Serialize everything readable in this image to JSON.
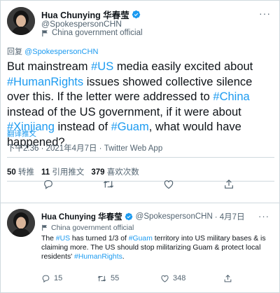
{
  "main_tweet": {
    "author_name": "Hua Chunying 华春莹",
    "handle": "@SpokespersonCHN",
    "label": "China government official",
    "reply_prefix": "回复",
    "reply_handle": "@SpokespersonCHN",
    "body": [
      {
        "t": "But mainstream "
      },
      {
        "t": "#US",
        "link": true
      },
      {
        "t": " media easily excited about "
      },
      {
        "t": "#HumanRights",
        "link": true
      },
      {
        "t": " issues showed collective silence over this. If the letter were addressed to "
      },
      {
        "t": "#China",
        "link": true
      },
      {
        "t": " instead of the US government, if it were about "
      },
      {
        "t": "#Xinjiang",
        "link": true
      },
      {
        "t": " instead of "
      },
      {
        "t": "#Guam",
        "link": true
      },
      {
        "t": ", what would have happened?"
      }
    ],
    "translate_label": "翻译推文",
    "timestamp": "下午2:36 · 2021年4月7日 · Twitter Web App",
    "stats": {
      "retweets_count": "50",
      "retweets_label": "转推",
      "quotes_count": "11",
      "quotes_label": "引用推文",
      "likes_count": "379",
      "likes_label": "喜欢次数"
    }
  },
  "reply_tweet": {
    "author_name": "Hua Chunying 华春莹",
    "handle": "@SpokespersonCHN",
    "date": "· 4月7日",
    "label": "China government official",
    "body": [
      {
        "t": "The "
      },
      {
        "t": "#US",
        "link": true
      },
      {
        "t": " has turned 1/3 of "
      },
      {
        "t": "#Guam",
        "link": true
      },
      {
        "t": " territory into US military bases & is claiming more. The US should stop militarizing Guam & protect local residents' "
      },
      {
        "t": "#HumanRights",
        "link": true
      },
      {
        "t": "."
      }
    ],
    "reply_count": "15",
    "retweet_count": "55",
    "like_count": "348"
  },
  "colors": {
    "accent": "#1d9bf0",
    "muted": "#536471",
    "text": "#0f1419",
    "divider": "#cfd9de"
  },
  "icons": [
    "verified-badge-icon",
    "government-flag-icon",
    "more-icon",
    "reply-icon",
    "retweet-icon",
    "like-icon",
    "share-icon"
  ]
}
